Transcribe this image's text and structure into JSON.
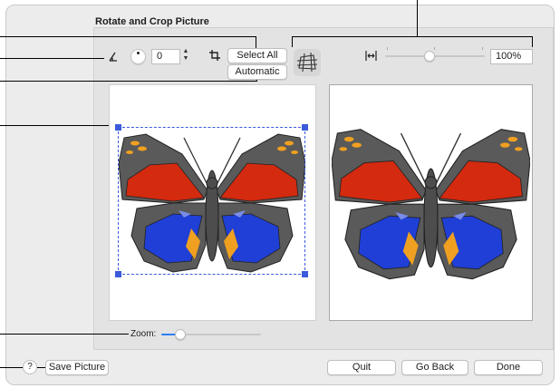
{
  "dialog": {
    "title": "Rotate and Crop Picture"
  },
  "rotate": {
    "angle_value": "0"
  },
  "crop": {
    "select_all_label": "Select All",
    "automatic_label": "Automatic"
  },
  "scale": {
    "value": "100%",
    "slider_fraction": 0.44
  },
  "zoom": {
    "label": "Zoom:",
    "slider_fraction": 0.15
  },
  "footer": {
    "help_label": "?",
    "save_label": "Save Picture",
    "quit_label": "Quit",
    "go_back_label": "Go Back",
    "done_label": "Done"
  },
  "colors": {
    "accent": "#3b5bdb",
    "wing_dark": "#5a5a5a",
    "wing_red": "#d42a0f",
    "wing_blue": "#1f3fd6",
    "wing_orange": "#f0a020"
  },
  "icons": {
    "angle": "angle-icon",
    "dial": "rotation-dial-icon",
    "crop": "crop-icon",
    "perspective": "perspective-icon",
    "fit": "fit-width-icon"
  }
}
